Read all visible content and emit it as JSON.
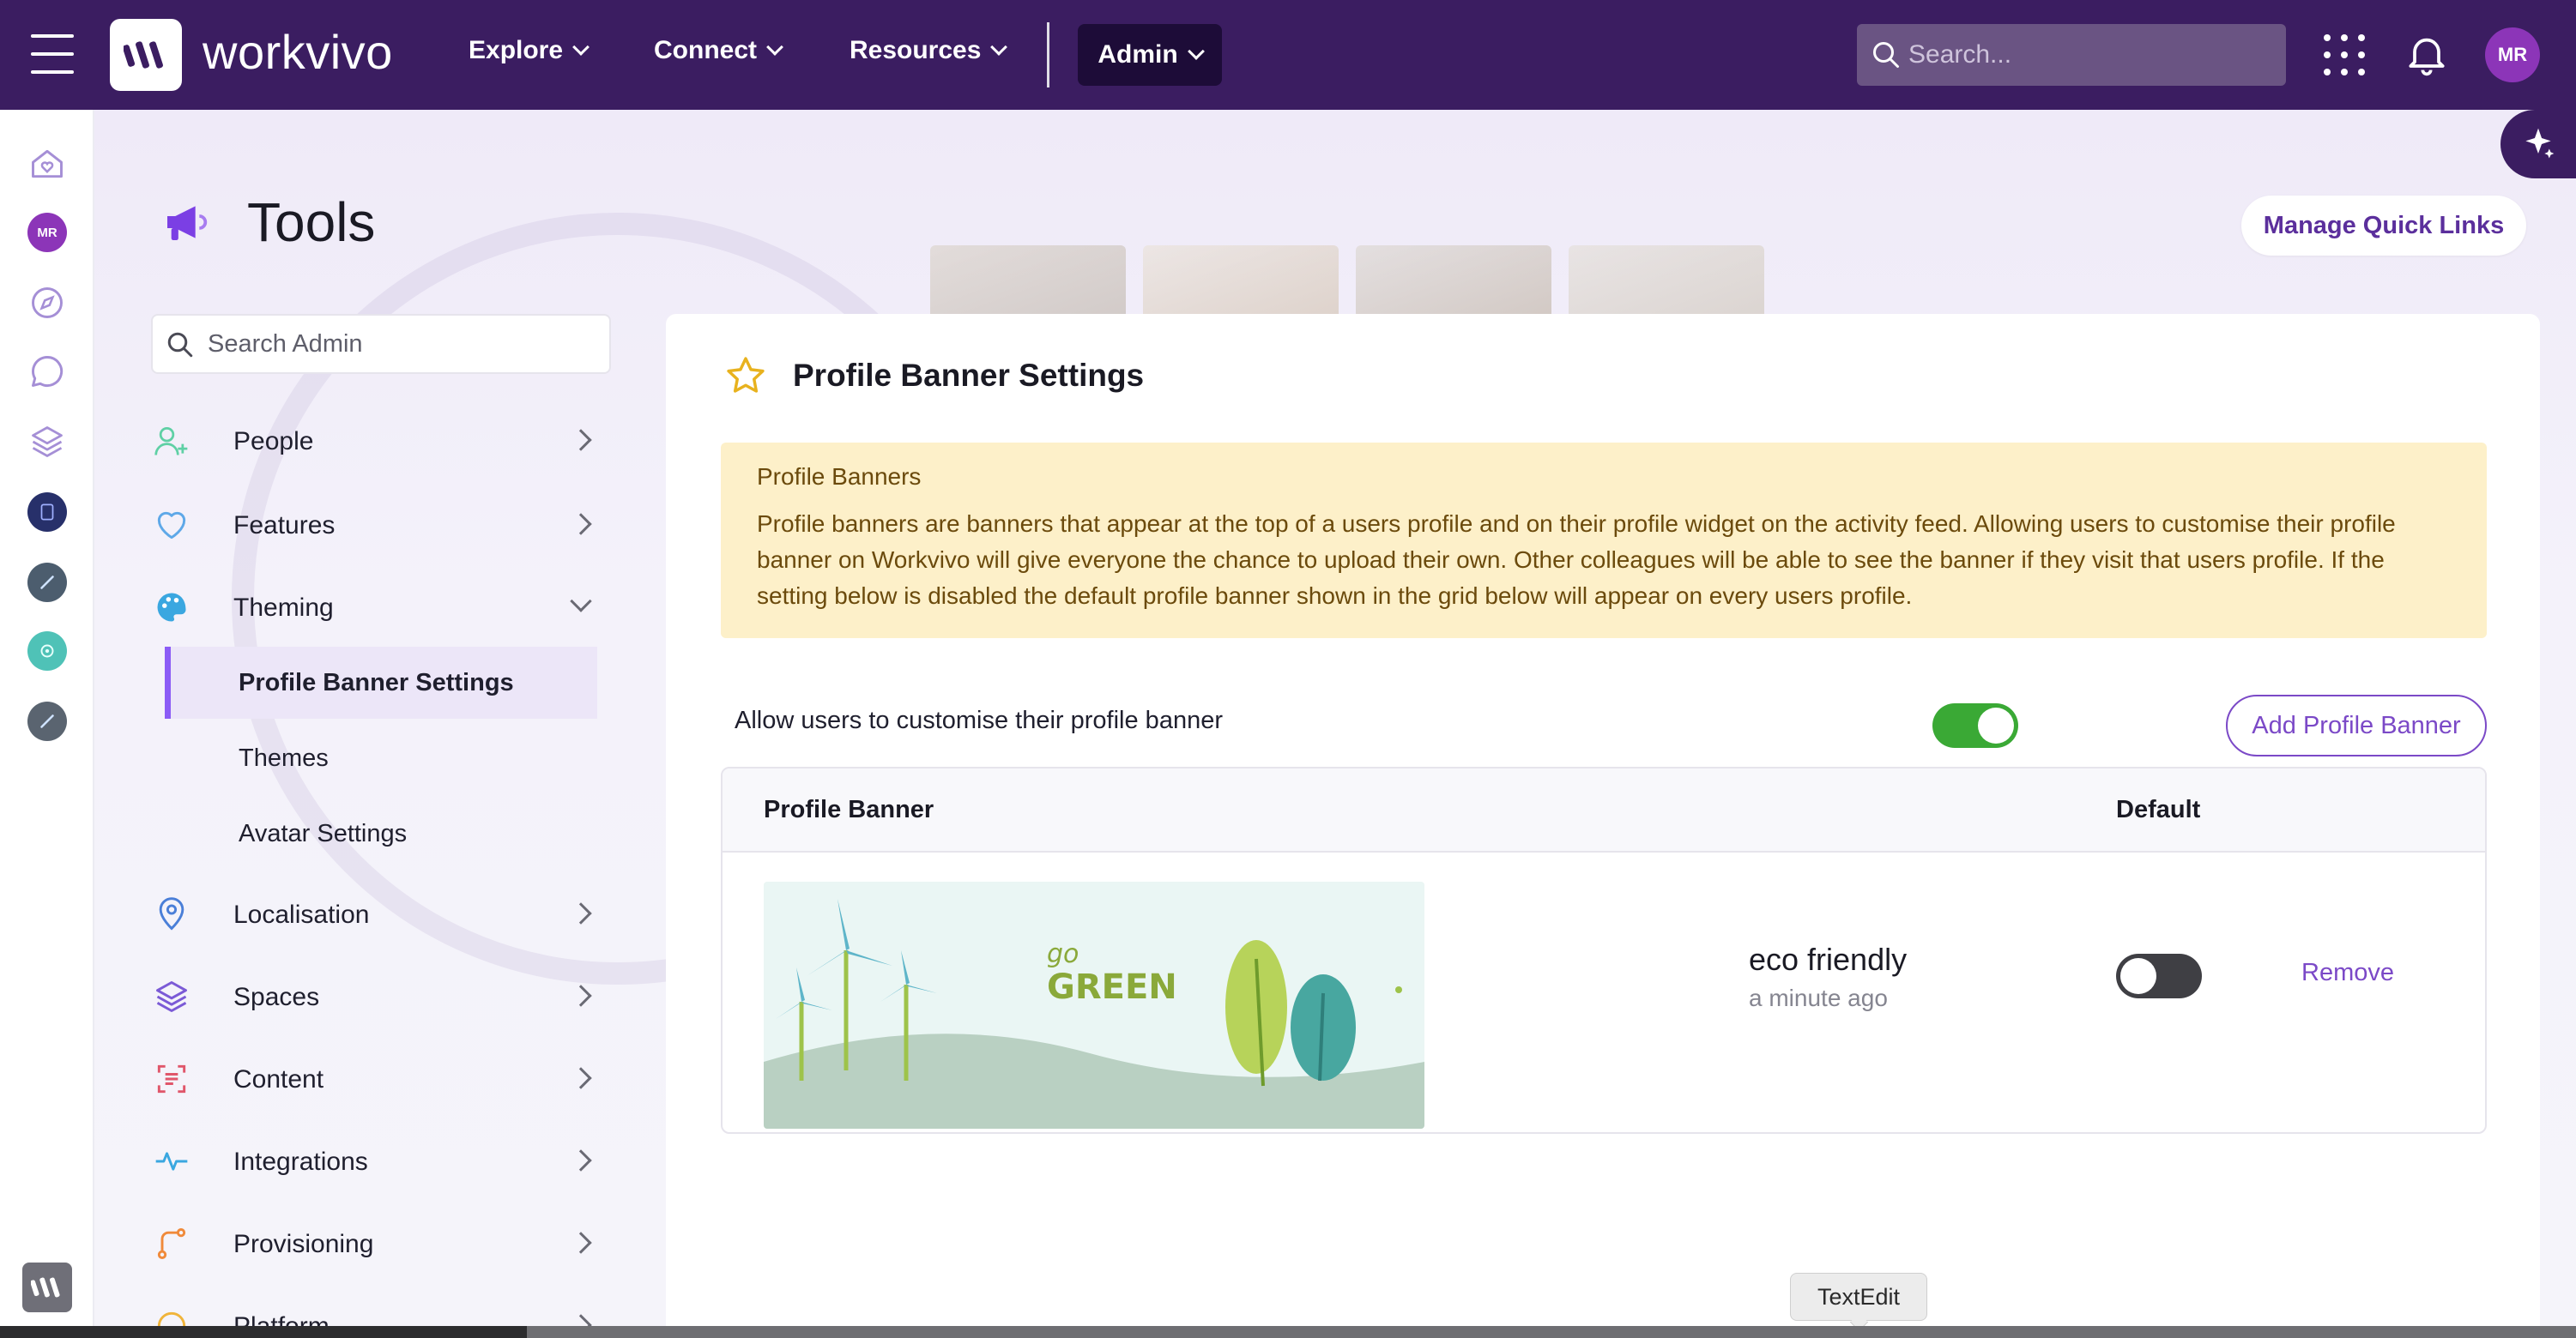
{
  "topbar": {
    "brand": "workvivo",
    "nav": [
      {
        "label": "Explore"
      },
      {
        "label": "Connect"
      },
      {
        "label": "Resources"
      }
    ],
    "admin_label": "Admin",
    "search_placeholder": "Search...",
    "avatar_initials": "MR"
  },
  "rail": {
    "avatar_initials": "MR"
  },
  "page": {
    "title": "Tools",
    "quick_links_label": "Manage Quick Links"
  },
  "sidebar": {
    "search_placeholder": "Search Admin",
    "items": [
      {
        "label": "People"
      },
      {
        "label": "Features"
      },
      {
        "label": "Theming"
      },
      {
        "label": "Localisation"
      },
      {
        "label": "Spaces"
      },
      {
        "label": "Content"
      },
      {
        "label": "Integrations"
      },
      {
        "label": "Provisioning"
      },
      {
        "label": "Platform"
      }
    ],
    "theming_sub": [
      {
        "label": "Profile Banner Settings",
        "active": true
      },
      {
        "label": "Themes"
      },
      {
        "label": "Avatar Settings"
      }
    ]
  },
  "card": {
    "title": "Profile Banner Settings",
    "notice_title": "Profile Banners",
    "notice_body": "Profile banners are banners that appear at the top of a users profile and on their profile widget on the activity feed. Allowing users to customise their profile banner on Workvivo will give everyone the chance to upload their own. Other colleagues will be able to see the banner if they visit that users profile. If the setting below is disabled the default profile banner shown in the grid below will appear on every users profile.",
    "toggle_label": "Allow users to customise their profile banner",
    "allow_customise": true,
    "add_button": "Add Profile Banner",
    "table": {
      "col_banner": "Profile Banner",
      "col_default": "Default",
      "rows": [
        {
          "name": "eco friendly",
          "time": "a minute ago",
          "default": false,
          "action": "Remove",
          "image_text": "go GREEN"
        }
      ]
    }
  },
  "tooltip": "TextEdit",
  "colors": {
    "nav_bg": "#3b1d61",
    "accent": "#7b49c7",
    "toggle_on": "#3aa935",
    "notice_bg": "#fdf0c9"
  }
}
